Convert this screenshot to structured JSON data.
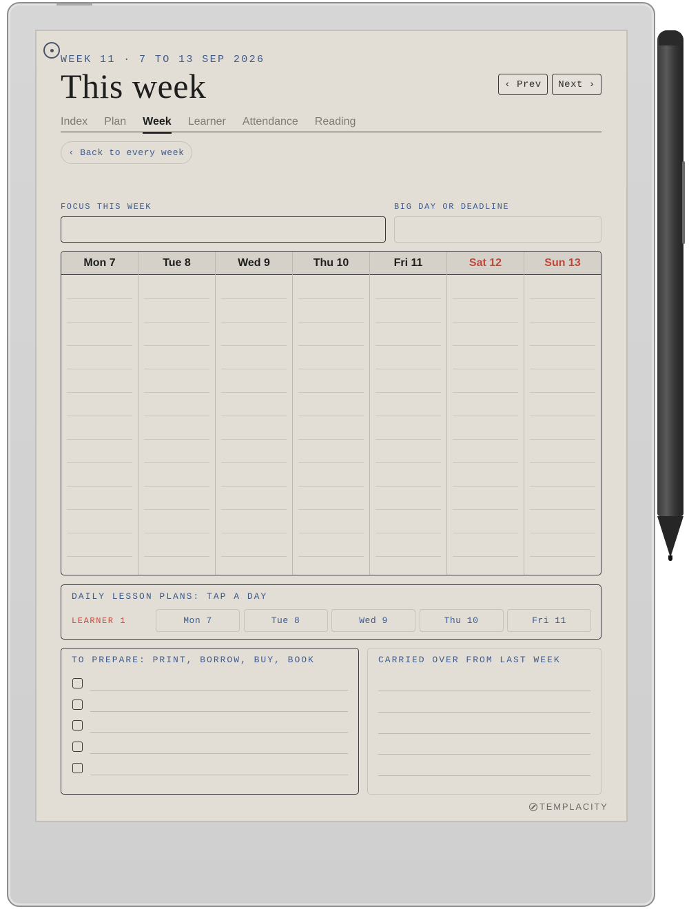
{
  "header": {
    "eyebrow": "WEEK 11 · 7 TO 13 SEP 2026",
    "title": "This week",
    "prev_label": "‹ Prev",
    "next_label": "Next ›"
  },
  "tabs": [
    {
      "label": "Index",
      "active": false
    },
    {
      "label": "Plan",
      "active": false
    },
    {
      "label": "Week",
      "active": true
    },
    {
      "label": "Learner",
      "active": false
    },
    {
      "label": "Attendance",
      "active": false
    },
    {
      "label": "Reading",
      "active": false
    }
  ],
  "back_label": "‹ Back to every week",
  "fields": {
    "focus_label": "FOCUS THIS WEEK",
    "focus_value": "",
    "deadline_label": "BIG DAY OR DEADLINE",
    "deadline_value": ""
  },
  "week": {
    "days": [
      {
        "label": "Mon 7",
        "weekend": false
      },
      {
        "label": "Tue 8",
        "weekend": false
      },
      {
        "label": "Wed 9",
        "weekend": false
      },
      {
        "label": "Thu 10",
        "weekend": false
      },
      {
        "label": "Fri 11",
        "weekend": false
      },
      {
        "label": "Sat 12",
        "weekend": true
      },
      {
        "label": "Sun 13",
        "weekend": true
      }
    ],
    "weekend_color": "#c0473a"
  },
  "lessons": {
    "title": "DAILY LESSON PLANS: TAP A DAY",
    "learner": "LEARNER 1",
    "days": [
      "Mon 7",
      "Tue 8",
      "Wed 9",
      "Thu 10",
      "Fri 11"
    ]
  },
  "prepare": {
    "title": "TO PREPARE: PRINT, BORROW, BUY, BOOK"
  },
  "carried": {
    "title": "CARRIED OVER FROM LAST WEEK"
  },
  "brand": "TEMPLACITY",
  "colors": {
    "accent_blue": "#3d5a8c",
    "accent_red": "#c0473a",
    "paper": "#e2ded6"
  }
}
